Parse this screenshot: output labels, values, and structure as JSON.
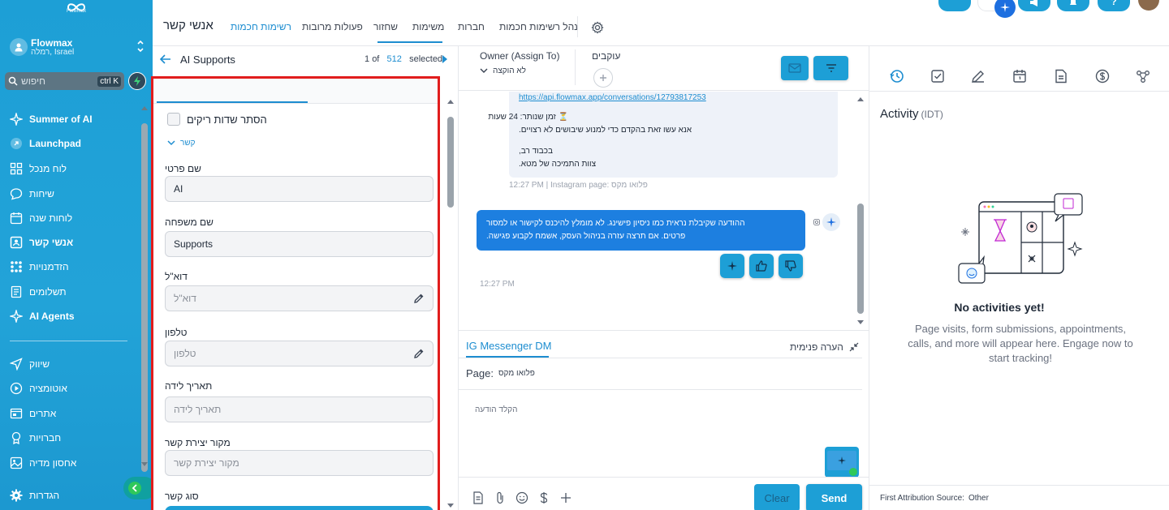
{
  "brand": {
    "logo_text": "Flowmax"
  },
  "account": {
    "name": "Flowmax",
    "location": "רמלה, Israel"
  },
  "search": {
    "placeholder": "חיפוש",
    "shortcut": "ctrl K"
  },
  "sidebar": {
    "items": [
      {
        "label": "Summer of AI",
        "icon": "sparkle-icon"
      },
      {
        "label": "Launchpad",
        "icon": "rocket-icon"
      },
      {
        "label": "לוח מנכל",
        "icon": "dashboard-icon"
      },
      {
        "label": "שיחות",
        "icon": "chat-icon"
      },
      {
        "label": "לוחות שנה",
        "icon": "calendar-icon"
      },
      {
        "label": "אנשי קשר",
        "icon": "contacts-icon"
      },
      {
        "label": "הזדמנויות",
        "icon": "opportunities-icon"
      },
      {
        "label": "תשלומים",
        "icon": "payments-icon"
      },
      {
        "label": "AI Agents",
        "icon": "ai-agents-icon"
      },
      {
        "label": "שיווק",
        "icon": "send-icon"
      },
      {
        "label": "אוטומציה",
        "icon": "automation-icon"
      },
      {
        "label": "אתרים",
        "icon": "sites-icon"
      },
      {
        "label": "חברויות",
        "icon": "memberships-icon"
      },
      {
        "label": "אחסון מדיה",
        "icon": "media-icon"
      }
    ],
    "settings_label": "הגדרות"
  },
  "topbar": {
    "page_title": "אנשי קשר",
    "tabs": [
      "רשימות חכמות",
      "פעולות מרובות",
      "שחזור",
      "משימות",
      "חברות",
      "נהל רשימות חכמות"
    ],
    "active_tab": "רשימות חכמות"
  },
  "record": {
    "name": "AI Supports",
    "position": "1",
    "of_label": "of",
    "total": "512",
    "selected_label": "selected"
  },
  "form": {
    "hide_empty_label": "הסתר שדות ריקים",
    "section_label": "קשר",
    "fields": [
      {
        "label": "שם פרטי",
        "value": "AI",
        "placeholder": ""
      },
      {
        "label": "שם משפחה",
        "value": "Supports",
        "placeholder": ""
      },
      {
        "label": "דוא\"ל",
        "value": "",
        "placeholder": "דוא\"ל"
      },
      {
        "label": "טלפון",
        "value": "",
        "placeholder": "טלפון"
      },
      {
        "label": "תאריך לידה",
        "value": "",
        "placeholder": "תאריך לידה"
      },
      {
        "label": "מקור יצירת קשר",
        "value": "",
        "placeholder": "מקור יצירת קשר"
      },
      {
        "label": "סוג קשר",
        "value": "",
        "placeholder": ""
      }
    ]
  },
  "conversation": {
    "owner_label": "Owner (Assign To)",
    "owner_value": "לא הוקצה",
    "followers_label": "עוקבים",
    "inbound": {
      "link": "https://api.flowmax.app/conversations/12793817253",
      "wait_line": "⏳ זמן שנותר: 24 שעות",
      "action_line": "אנא עשו זאת בהקדם כדי למנוע שיבושים לא רצויים.",
      "closing": "בכבוד רב,",
      "signature": "צוות התמיכה של מטא.",
      "meta": "12:27 PM | Instagram page: פלואו מקס"
    },
    "outbound": {
      "line1": "ההודעה שקיבלת נראית כמו ניסיון פישינג. לא מומלץ להיכנס לקישור או למסור",
      "line2": "פרטים. אם תרצה עזרה בניהול העסק, אשמח לקבוע פגישה.",
      "time": "12:27 PM"
    }
  },
  "composer": {
    "channel_tab": "IG Messenger DM",
    "internal_note": "הערה פנימית",
    "page_label": "Page:",
    "page_value": "פלואו מקס",
    "placeholder": "הקלד הודעה",
    "clear_label": "Clear",
    "send_label": "Send"
  },
  "activity": {
    "title": "Activity",
    "timezone": "(IDT)",
    "empty_title": "No activities yet!",
    "empty_sub": "Page visits, form submissions, appointments, calls, and more will appear here. Engage now to start tracking!",
    "attribution_label": "First Attribution Source:",
    "attribution_value": "Other"
  },
  "colors": {
    "accent": "#1d9fd6",
    "brand_blue": "#1d8dd0",
    "highlight_border": "#e11d1d"
  }
}
